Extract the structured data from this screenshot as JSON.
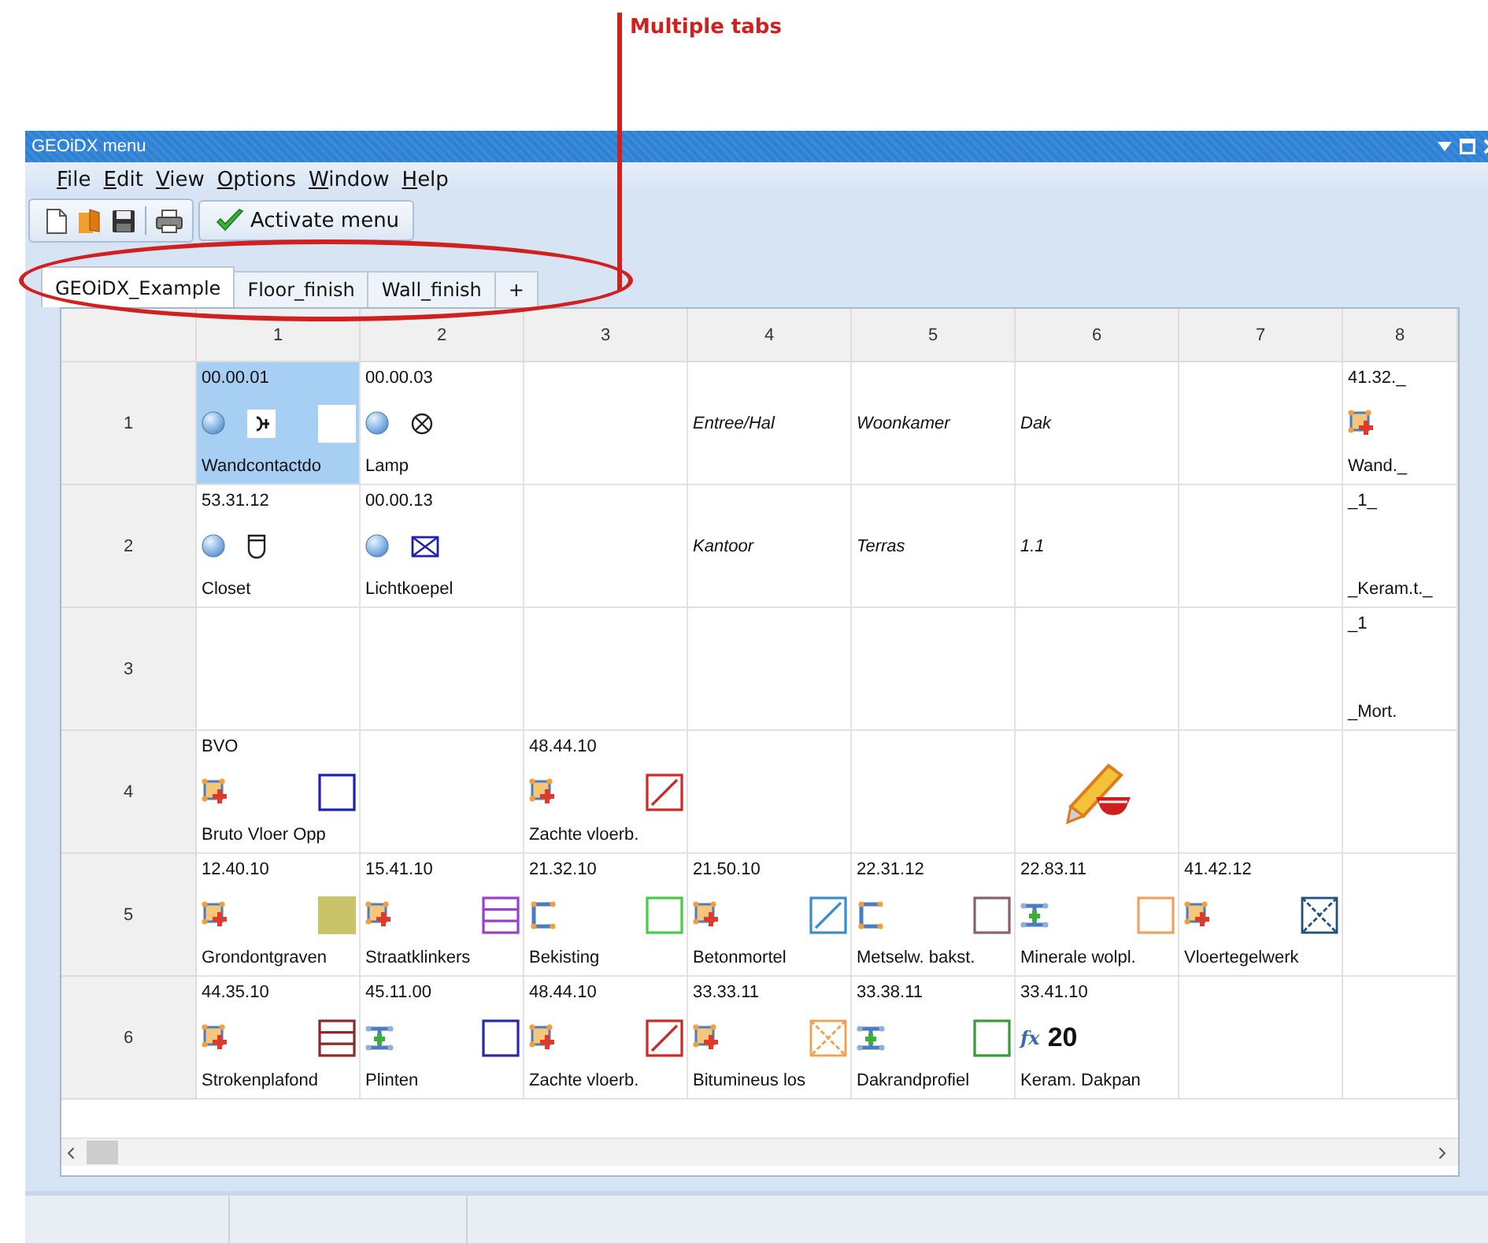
{
  "annotation": {
    "text": "Multiple tabs"
  },
  "window": {
    "title": "GEOiDX menu"
  },
  "menu": [
    "File",
    "Edit",
    "View",
    "Options",
    "Window",
    "Help"
  ],
  "toolbar": {
    "button": "Activate menu"
  },
  "tabs": [
    {
      "label": "GEOiDX_Example",
      "selected": true
    },
    {
      "label": "Floor_finish",
      "selected": false
    },
    {
      "label": "Wall_finish",
      "selected": false
    },
    {
      "label": "+",
      "selected": false
    }
  ],
  "grid": {
    "columns": [
      "1",
      "2",
      "3",
      "4",
      "5",
      "6",
      "7",
      "8"
    ],
    "rows": [
      {
        "header": "1",
        "cells": [
          {
            "kind": "element",
            "code": "00.00.01",
            "icon": {
              "kind": "sphere"
            },
            "symbol": {
              "kind": "socket"
            },
            "swatch": {
              "kind": "fill",
              "color": "#ffffff"
            },
            "name": "Wandcontactdo",
            "selected": true
          },
          {
            "kind": "element",
            "code": "00.00.03",
            "icon": {
              "kind": "sphere"
            },
            "symbol": {
              "kind": "lamp"
            },
            "name": "Lamp",
            "selected": false
          },
          {
            "kind": "empty",
            "selected": false
          },
          {
            "kind": "label",
            "text": "Entree/Hal",
            "selected": false
          },
          {
            "kind": "label",
            "text": "Woonkamer",
            "selected": false
          },
          {
            "kind": "label",
            "text": "Dak",
            "selected": false
          },
          {
            "kind": "empty",
            "selected": false
          },
          {
            "kind": "element",
            "code": "41.32._",
            "icon": {
              "kind": "element"
            },
            "name": "Wand._",
            "selected": false
          }
        ]
      },
      {
        "header": "2",
        "cells": [
          {
            "kind": "element",
            "code": "53.31.12",
            "icon": {
              "kind": "sphere"
            },
            "symbol": {
              "kind": "closet"
            },
            "name": "Closet",
            "selected": false
          },
          {
            "kind": "element",
            "code": "00.00.13",
            "icon": {
              "kind": "sphere"
            },
            "symbol": {
              "kind": "skylight"
            },
            "name": "Lichtkoepel",
            "selected": false
          },
          {
            "kind": "empty",
            "selected": false
          },
          {
            "kind": "label",
            "text": "Kantoor",
            "selected": false
          },
          {
            "kind": "label",
            "text": "Terras",
            "selected": false
          },
          {
            "kind": "label",
            "text": "1.1",
            "selected": false
          },
          {
            "kind": "empty",
            "selected": false
          },
          {
            "kind": "element",
            "code": "_1_",
            "name": "_Keram.t._",
            "selected": false
          }
        ]
      },
      {
        "header": "3",
        "cells": [
          {
            "kind": "empty",
            "selected": false
          },
          {
            "kind": "empty",
            "selected": false
          },
          {
            "kind": "empty",
            "selected": false
          },
          {
            "kind": "empty",
            "selected": false
          },
          {
            "kind": "empty",
            "selected": false
          },
          {
            "kind": "empty",
            "selected": false
          },
          {
            "kind": "empty",
            "selected": false
          },
          {
            "kind": "element",
            "code": "_1",
            "name": "_Mort.",
            "selected": false
          }
        ]
      },
      {
        "header": "4",
        "cells": [
          {
            "kind": "element",
            "code": "BVO",
            "icon": {
              "kind": "element"
            },
            "swatch": {
              "kind": "outline",
              "color": "#1c22b0"
            },
            "name": "Bruto Vloer Opp",
            "selected": false
          },
          {
            "kind": "empty",
            "selected": false
          },
          {
            "kind": "element",
            "code": "48.44.10",
            "icon": {
              "kind": "element"
            },
            "swatch": {
              "kind": "diagonal",
              "color": "#cc2a2a"
            },
            "name": "Zachte vloerb.",
            "selected": false
          },
          {
            "kind": "empty",
            "selected": false
          },
          {
            "kind": "empty",
            "selected": false
          },
          {
            "kind": "tool",
            "selected": false
          },
          {
            "kind": "empty",
            "selected": false
          },
          {
            "kind": "empty",
            "selected": false
          }
        ]
      },
      {
        "header": "5",
        "cells": [
          {
            "kind": "element",
            "code": "12.40.10",
            "icon": {
              "kind": "element"
            },
            "swatch": {
              "kind": "fill",
              "color": "#c9c46a"
            },
            "name": "Grondontgraven",
            "selected": false
          },
          {
            "kind": "element",
            "code": "15.41.10",
            "icon": {
              "kind": "element"
            },
            "swatch": {
              "kind": "lines",
              "color": "#9a40c8"
            },
            "name": "Straatklinkers",
            "selected": false
          },
          {
            "kind": "element",
            "code": "21.32.10",
            "icon": {
              "kind": "formwork"
            },
            "swatch": {
              "kind": "outline",
              "color": "#44cc44"
            },
            "name": "Bekisting",
            "selected": false
          },
          {
            "kind": "element",
            "code": "21.50.10",
            "icon": {
              "kind": "element"
            },
            "swatch": {
              "kind": "diagonal",
              "color": "#3a8ec8"
            },
            "name": "Betonmortel",
            "selected": false
          },
          {
            "kind": "element",
            "code": "22.31.12",
            "icon": {
              "kind": "formwork"
            },
            "swatch": {
              "kind": "outline",
              "color": "#8a6070"
            },
            "name": "Metselw. bakst.",
            "selected": false
          },
          {
            "kind": "element",
            "code": "22.83.11",
            "icon": {
              "kind": "profile"
            },
            "swatch": {
              "kind": "outline",
              "color": "#f0a060"
            },
            "name": "Minerale wolpl.",
            "selected": false
          },
          {
            "kind": "element",
            "code": "41.42.12",
            "icon": {
              "kind": "element"
            },
            "swatch": {
              "kind": "cross",
              "color": "#205080"
            },
            "name": "Vloertegelwerk",
            "selected": false
          },
          {
            "kind": "empty",
            "selected": false
          }
        ]
      },
      {
        "header": "6",
        "cells": [
          {
            "kind": "element",
            "code": "44.35.10",
            "icon": {
              "kind": "element"
            },
            "swatch": {
              "kind": "lines",
              "color": "#8a2a2a"
            },
            "name": "Strokenplafond",
            "selected": false
          },
          {
            "kind": "element",
            "code": "45.11.00",
            "icon": {
              "kind": "profile"
            },
            "swatch": {
              "kind": "outline",
              "color": "#2a2aa0"
            },
            "name": "Plinten",
            "selected": false
          },
          {
            "kind": "element",
            "code": "48.44.10",
            "icon": {
              "kind": "element"
            },
            "swatch": {
              "kind": "diagonal",
              "color": "#cc2a2a"
            },
            "name": "Zachte vloerb.",
            "selected": false
          },
          {
            "kind": "element",
            "code": "33.33.11",
            "icon": {
              "kind": "element"
            },
            "swatch": {
              "kind": "cross",
              "color": "#f0a050"
            },
            "name": "Bitumineus los",
            "selected": false
          },
          {
            "kind": "element",
            "code": "33.38.11",
            "icon": {
              "kind": "profile"
            },
            "swatch": {
              "kind": "outline",
              "color": "#3a9a3a"
            },
            "name": "Dakrandprofiel",
            "selected": false
          },
          {
            "kind": "formula",
            "code": "33.41.10",
            "prefix": "fx",
            "value": "20",
            "name": "Keram. Dakpan",
            "selected": false
          },
          {
            "kind": "empty",
            "selected": false
          },
          {
            "kind": "empty",
            "selected": false
          }
        ]
      }
    ]
  }
}
